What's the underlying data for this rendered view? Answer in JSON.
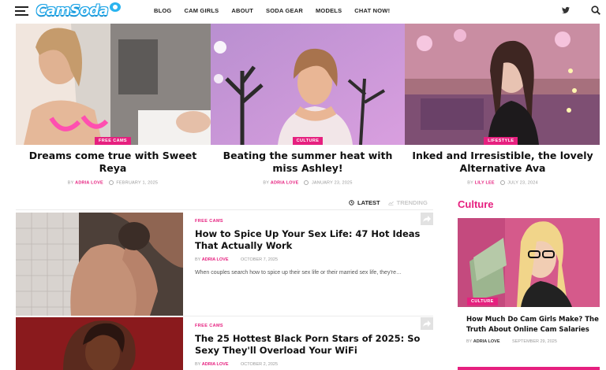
{
  "header": {
    "logo_text": "CamSoda",
    "nav": [
      "BLOG",
      "CAM GIRLS",
      "ABOUT",
      "SODA GEAR",
      "MODELS",
      "CHAT NOW!"
    ],
    "icons": [
      "menu-icon",
      "twitter-icon",
      "search-icon"
    ]
  },
  "featured": [
    {
      "category": "FREE CAMS",
      "title": "Dreams come true with Sweet Reya",
      "by": "BY",
      "author": "ADRIA LOVE",
      "date": "FEBRUARY 1, 2025"
    },
    {
      "category": "CULTURE",
      "title": "Beating the summer heat with miss Ashley!",
      "by": "BY",
      "author": "ADRIA LOVE",
      "date": "JANUARY 23, 2025"
    },
    {
      "category": "LIFESTYLE",
      "title": "Inked and Irresistible, the lovely Alternative Ava",
      "by": "BY",
      "author": "LILY LEE",
      "date": "JULY 23, 2024"
    }
  ],
  "tabs": {
    "latest": "LATEST",
    "trending": "TRENDING"
  },
  "posts": [
    {
      "category": "FREE CAMS",
      "title": "How to Spice Up Your Sex Life: 47 Hot Ideas That Actually Work",
      "by": "BY",
      "author": "ADRIA LOVE",
      "date": "OCTOBER 7, 2025",
      "excerpt": "When couples search how to spice up their sex life or their married sex life, they're…"
    },
    {
      "category": "FREE CAMS",
      "title": "The 25 Hottest Black Porn Stars of 2025: So Sexy They'll Overload Your WiFi",
      "by": "BY",
      "author": "ADRIA LOVE",
      "date": "OCTOBER 2, 2025"
    }
  ],
  "sidebar": {
    "title": "Culture",
    "category": "CULTURE",
    "headline": "How Much Do Cam Girls Make? The Truth About Online Cam Salaries",
    "by": "BY",
    "author": "ADRIA LOVE",
    "date": "SEPTEMBER 29, 2025"
  },
  "colors": {
    "accent": "#e6207f",
    "logo": "#1aa3e6"
  }
}
